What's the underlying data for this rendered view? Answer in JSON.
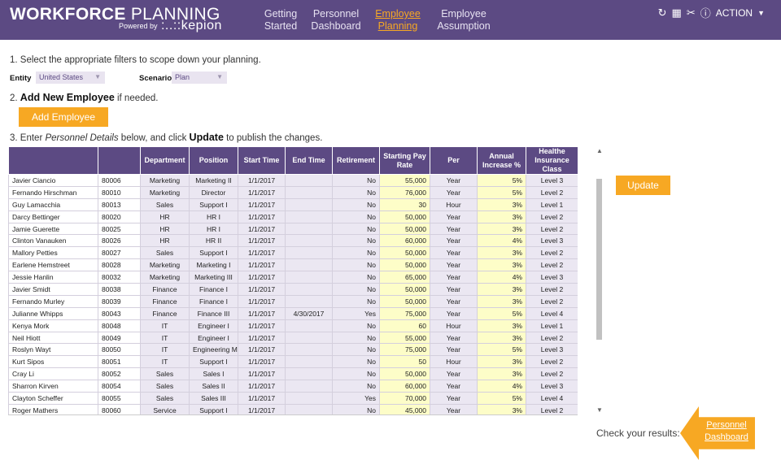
{
  "header": {
    "brand_bold": "WORKFORCE",
    "brand_light": "PLANNING",
    "powered_by": "Powered by",
    "powered_logo": ":..::kepion",
    "nav": [
      {
        "line1": "Getting",
        "line2": "Started"
      },
      {
        "line1": "Personnel",
        "line2": "Dashboard"
      },
      {
        "line1": "Employee",
        "line2": "Planning",
        "active": true
      },
      {
        "line1": "Employee",
        "line2": "Assumption"
      }
    ],
    "action_label": "ACTION",
    "icons": [
      "refresh-icon",
      "excel-icon",
      "attachment-icon",
      "info-icon",
      "caret-down-icon"
    ]
  },
  "steps": {
    "step1": "1. Select the appropriate filters to scope down your planning.",
    "step2_prefix": "2. ",
    "step2_bold": "Add New Employee",
    "step2_suffix": " if needed.",
    "step3_prefix": "3. Enter ",
    "step3_italic": "Personnel Details",
    "step3_mid": " below, and click ",
    "step3_bold": "Update",
    "step3_suffix": " to publish the changes."
  },
  "filters": {
    "entity_label": "Entity",
    "entity_value": "United States",
    "scenario_label": "Scenario",
    "scenario_value": "Plan"
  },
  "buttons": {
    "add_employee": "Add Employee",
    "update": "Update"
  },
  "table": {
    "headers": [
      "",
      "",
      "Department",
      "Position",
      "Start Time",
      "End Time",
      "Retirement",
      "Starting Pay Rate",
      "Per",
      "Annual Increase %",
      "Healthe Insurance Class"
    ],
    "rows": [
      [
        "Javier Ciancio",
        "80006",
        "Marketing",
        "Marketing II",
        "1/1/2017",
        "",
        "No",
        "55,000",
        "Year",
        "5%",
        "Level 3"
      ],
      [
        "Fernando Hirschman",
        "80010",
        "Marketing",
        "Director",
        "1/1/2017",
        "",
        "No",
        "76,000",
        "Year",
        "5%",
        "Level 2"
      ],
      [
        "Guy Lamacchia",
        "80013",
        "Sales",
        "Support I",
        "1/1/2017",
        "",
        "No",
        "30",
        "Hour",
        "3%",
        "Level 1"
      ],
      [
        "Darcy Bettinger",
        "80020",
        "HR",
        "HR I",
        "1/1/2017",
        "",
        "No",
        "50,000",
        "Year",
        "3%",
        "Level 2"
      ],
      [
        "Jamie Guerette",
        "80025",
        "HR",
        "HR I",
        "1/1/2017",
        "",
        "No",
        "50,000",
        "Year",
        "3%",
        "Level 2"
      ],
      [
        "Clinton Vanauken",
        "80026",
        "HR",
        "HR II",
        "1/1/2017",
        "",
        "No",
        "60,000",
        "Year",
        "4%",
        "Level 3"
      ],
      [
        "Mallory Petties",
        "80027",
        "Sales",
        "Support I",
        "1/1/2017",
        "",
        "No",
        "50,000",
        "Year",
        "3%",
        "Level 2"
      ],
      [
        "Earlene Hemstreet",
        "80028",
        "Marketing",
        "Marketing I",
        "1/1/2017",
        "",
        "No",
        "50,000",
        "Year",
        "3%",
        "Level 2"
      ],
      [
        "Jessie Hanlin",
        "80032",
        "Marketing",
        "Marketing III",
        "1/1/2017",
        "",
        "No",
        "65,000",
        "Year",
        "4%",
        "Level 3"
      ],
      [
        "Javier Smidt",
        "80038",
        "Finance",
        "Finance I",
        "1/1/2017",
        "",
        "No",
        "50,000",
        "Year",
        "3%",
        "Level 2"
      ],
      [
        "Fernando Murley",
        "80039",
        "Finance",
        "Finance I",
        "1/1/2017",
        "",
        "No",
        "50,000",
        "Year",
        "3%",
        "Level 2"
      ],
      [
        "Julianne Whipps",
        "80043",
        "Finance",
        "Finance III",
        "1/1/2017",
        "4/30/2017",
        "Yes",
        "75,000",
        "Year",
        "5%",
        "Level 4"
      ],
      [
        "Kenya Mork",
        "80048",
        "IT",
        "Engineer I",
        "1/1/2017",
        "",
        "No",
        "60",
        "Hour",
        "3%",
        "Level 1"
      ],
      [
        "Neil Hiott",
        "80049",
        "IT",
        "Engineer I",
        "1/1/2017",
        "",
        "No",
        "55,000",
        "Year",
        "3%",
        "Level 2"
      ],
      [
        "Roslyn Wayt",
        "80050",
        "IT",
        "Engineering Ma",
        "1/1/2017",
        "",
        "No",
        "75,000",
        "Year",
        "5%",
        "Level 3"
      ],
      [
        "Kurt Sipos",
        "80051",
        "IT",
        "Support I",
        "1/1/2017",
        "",
        "No",
        "50",
        "Hour",
        "3%",
        "Level 2"
      ],
      [
        "Cray Li",
        "80052",
        "Sales",
        "Sales I",
        "1/1/2017",
        "",
        "No",
        "50,000",
        "Year",
        "3%",
        "Level 2"
      ],
      [
        "Sharron Kirven",
        "80054",
        "Sales",
        "Sales II",
        "1/1/2017",
        "",
        "No",
        "60,000",
        "Year",
        "4%",
        "Level 3"
      ],
      [
        "Clayton Scheffer",
        "80055",
        "Sales",
        "Sales III",
        "1/1/2017",
        "",
        "Yes",
        "70,000",
        "Year",
        "5%",
        "Level 4"
      ],
      [
        "Roger Mathers",
        "80060",
        "Service",
        "Support I",
        "1/1/2017",
        "",
        "No",
        "45,000",
        "Year",
        "3%",
        "Level 2"
      ]
    ]
  },
  "footer": {
    "check_results": "Check your results:",
    "dashboard_line1": "Personnel",
    "dashboard_line2": "Dashboard"
  },
  "colors": {
    "header_bg": "#5c4a83",
    "accent_orange": "#f7a823",
    "cell_lavender": "#ebe7f2",
    "cell_yellow": "#fdfdc8"
  }
}
